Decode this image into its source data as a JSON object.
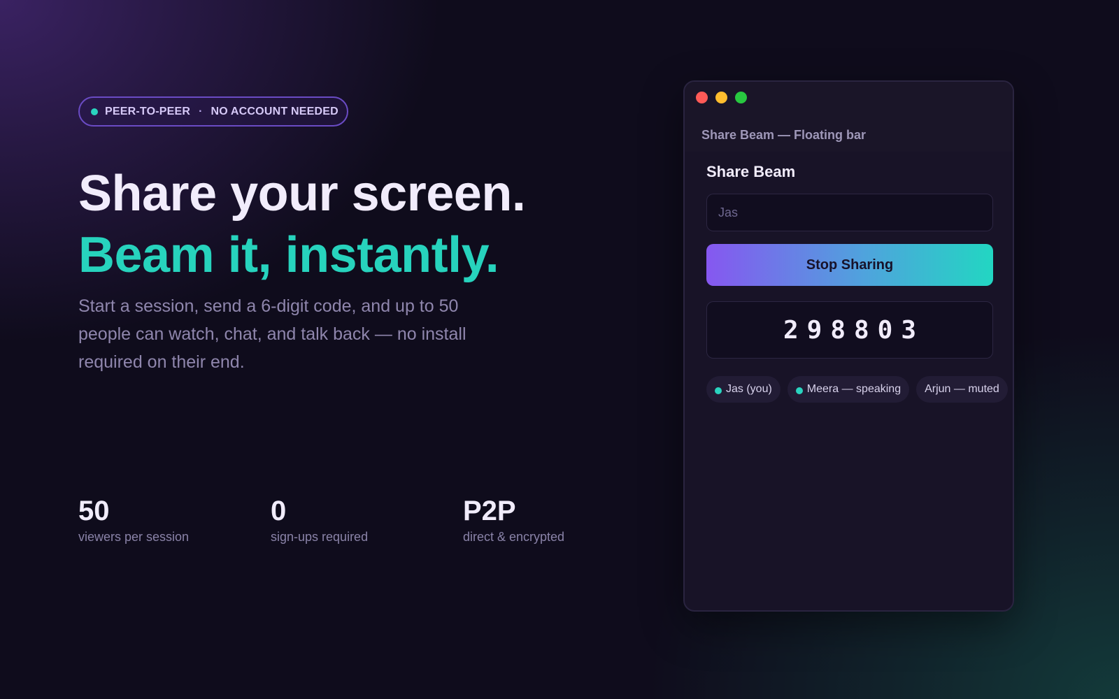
{
  "hero": {
    "badge": {
      "left": "PEER-TO-PEER",
      "separator": "·",
      "right": "NO ACCOUNT NEEDED"
    },
    "headline": "Share your screen.",
    "headline_accent": "Beam it, instantly.",
    "subtitle": "Start a session, send a 6-digit code, and up to 50 people can watch, chat, and talk back — no install required on their end.",
    "stats": [
      {
        "value": "50",
        "label": "viewers per session"
      },
      {
        "value": "0",
        "label": "sign-ups required"
      },
      {
        "value": "P2P",
        "label": "direct & encrypted"
      }
    ]
  },
  "window": {
    "title": "Share Beam — Floating bar",
    "panel_title": "Share Beam",
    "name_input": {
      "value": "",
      "placeholder": "Jas"
    },
    "stop_button": "Stop Sharing",
    "session_code": "298803",
    "participants": [
      {
        "label": "Jas (you)",
        "status_dot": true
      },
      {
        "label": "Meera — speaking",
        "status_dot": true
      },
      {
        "label": "Arjun — muted",
        "status_dot": false
      }
    ]
  },
  "colors": {
    "accent_teal": "#27d3bd",
    "accent_purple": "#8657f0",
    "badge_border": "#6a4bc4",
    "traffic_red": "#ff5a57",
    "traffic_yellow": "#ffbd2e",
    "traffic_green": "#28c840"
  }
}
